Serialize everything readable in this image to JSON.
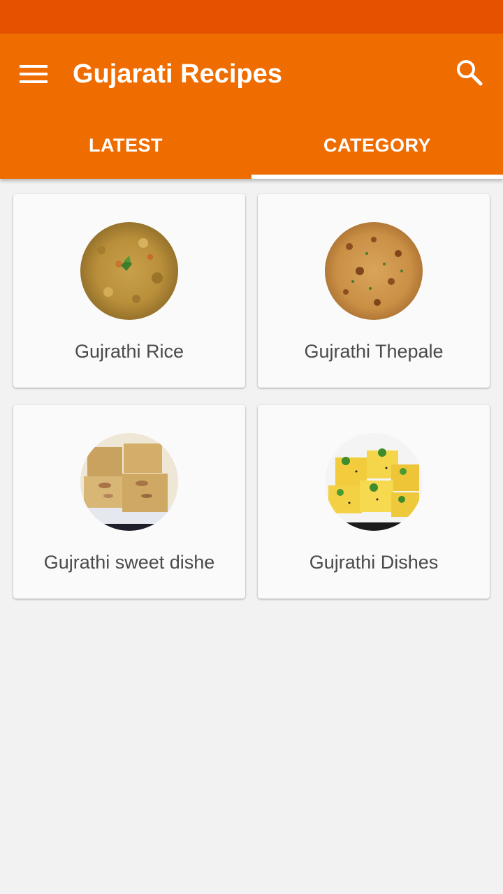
{
  "app_bar": {
    "title": "Gujarati Recipes",
    "menu_icon": "hamburger-menu-icon",
    "search_icon": "search-icon",
    "color": "#ef6c00",
    "status_bar_color": "#e65100"
  },
  "tabs": [
    {
      "label": "LATEST",
      "active": false
    },
    {
      "label": "CATEGORY",
      "active": true
    }
  ],
  "categories": [
    {
      "label": "Gujrathi Rice",
      "image": "rice-dish-image"
    },
    {
      "label": "Gujrathi Thepale",
      "image": "thepla-flatbread-image"
    },
    {
      "label": "Gujrathi sweet dishe",
      "image": "sweet-barfi-image"
    },
    {
      "label": "Gujrathi Dishes",
      "image": "dhokla-image"
    }
  ]
}
